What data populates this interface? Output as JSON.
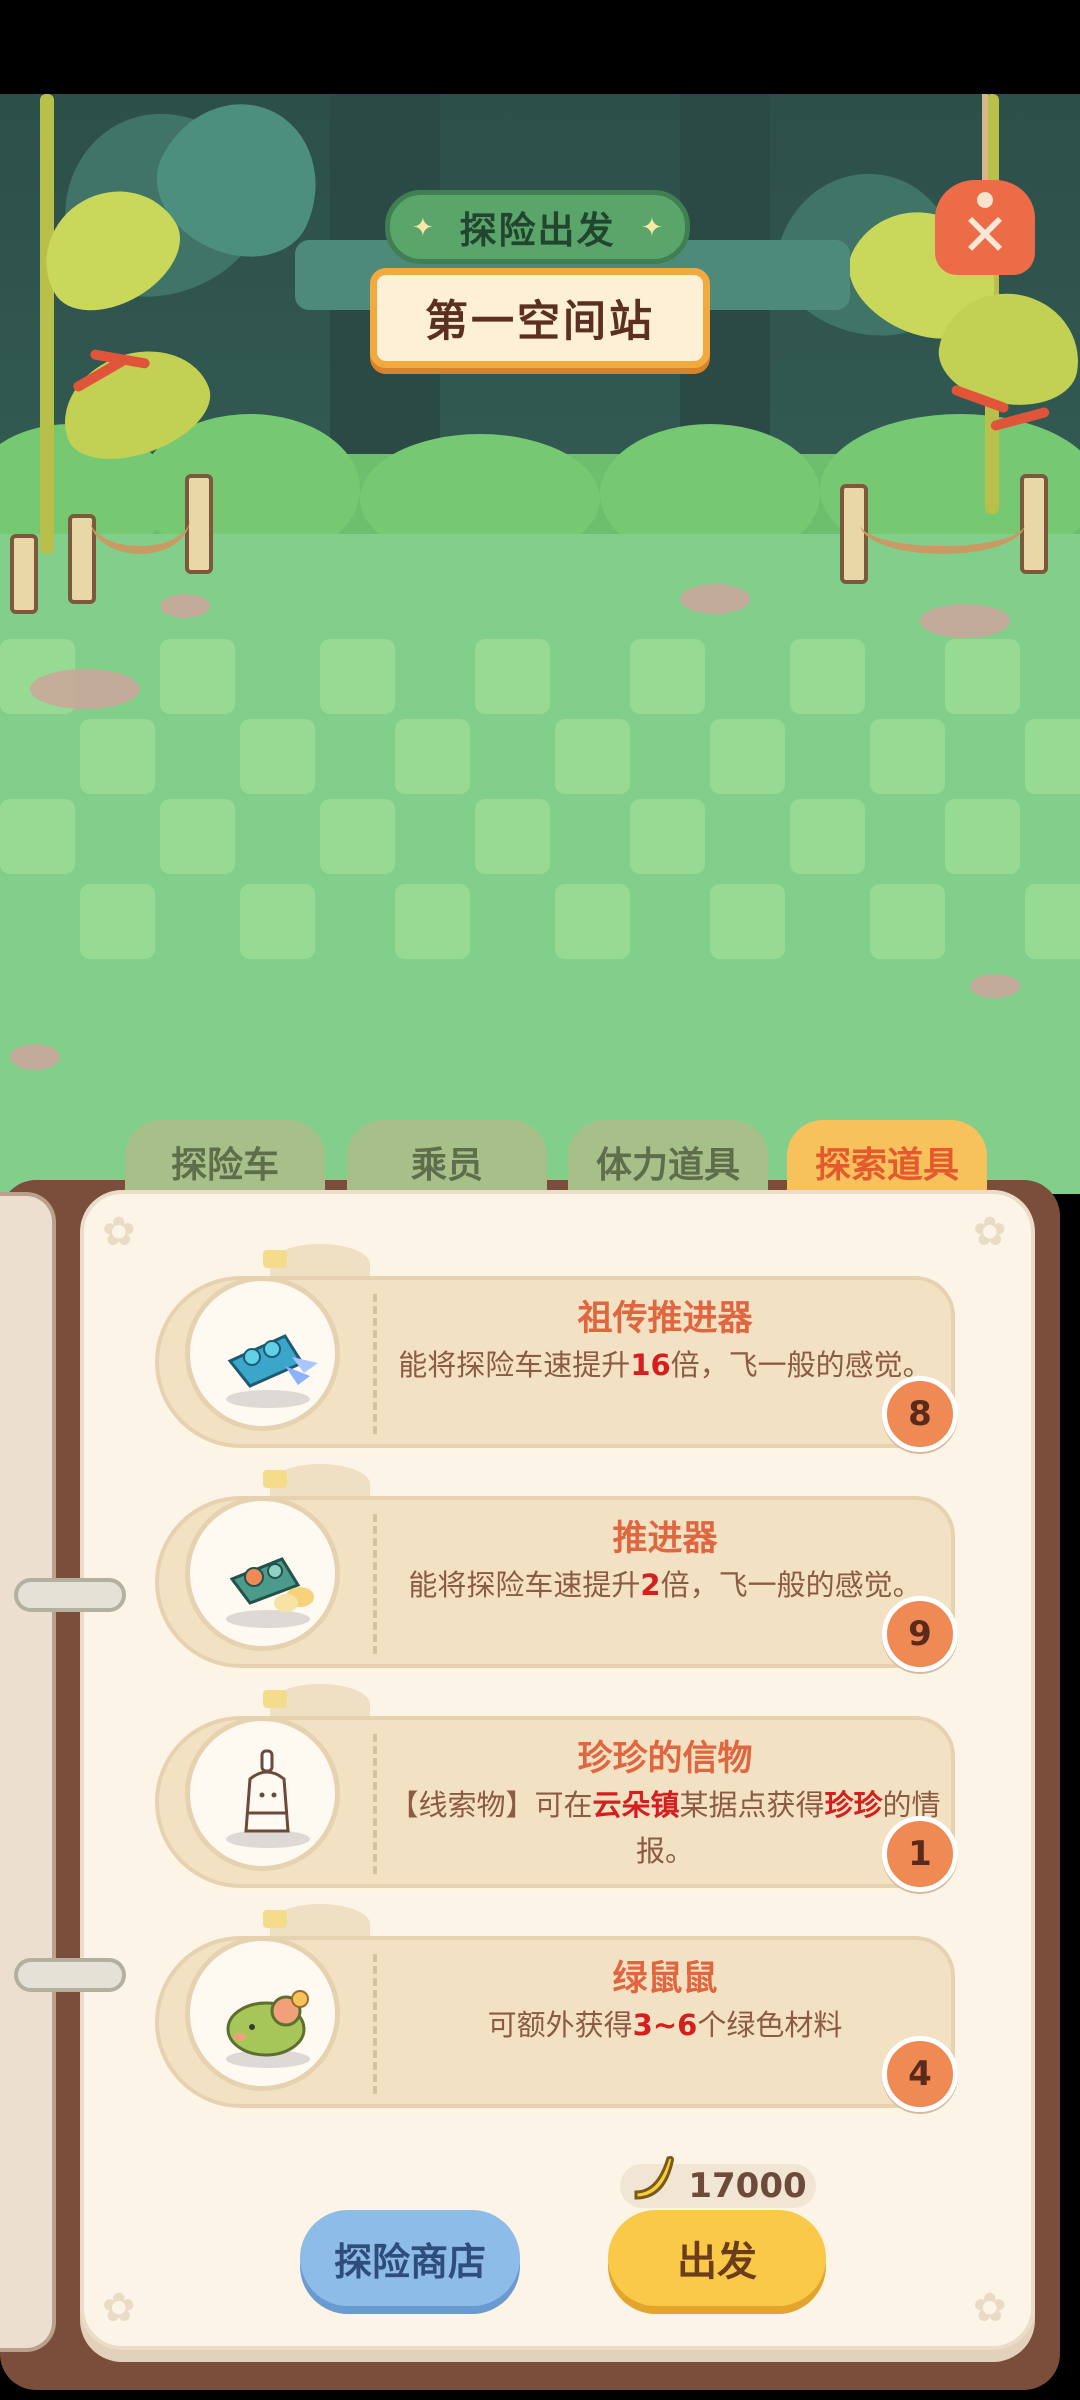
{
  "header": {
    "banner_title": "探险出发",
    "station_name": "第一空间站"
  },
  "tabs": [
    {
      "label": "探险车",
      "active": false
    },
    {
      "label": "乘员",
      "active": false
    },
    {
      "label": "体力道具",
      "active": false
    },
    {
      "label": "探索道具",
      "active": true
    }
  ],
  "items": [
    {
      "name": "祖传推进器",
      "desc_parts": [
        "能将探险车速提升",
        "16",
        "倍，飞一般的感觉。"
      ],
      "count": "8",
      "icon": "ancestral-thruster-icon"
    },
    {
      "name": "推进器",
      "desc_parts": [
        "能将探险车速提升",
        "2",
        "倍，飞一般的感觉。"
      ],
      "count": "9",
      "icon": "thruster-icon"
    },
    {
      "name": "珍珍的信物",
      "desc_parts": [
        "【线索物】可在",
        "云朵镇",
        "某据点获得",
        "珍珍",
        "的情报。"
      ],
      "count": "1",
      "icon": "bottle-token-icon"
    },
    {
      "name": "绿鼠鼠",
      "desc_parts": [
        "可额外获得",
        "3~6",
        "个绿色材料"
      ],
      "count": "4",
      "icon": "green-mouse-icon"
    }
  ],
  "footer": {
    "currency_icon": "banana-icon",
    "currency_amount": "17000",
    "shop_label": "探险商店",
    "depart_label": "出发"
  },
  "colors": {
    "active_tab": "#f7c15b",
    "item_title": "#e0663f",
    "highlight": "#d51f1f",
    "count_badge": "#f08a55",
    "shop_button": "#8dbce8",
    "depart_button": "#f9c947"
  }
}
